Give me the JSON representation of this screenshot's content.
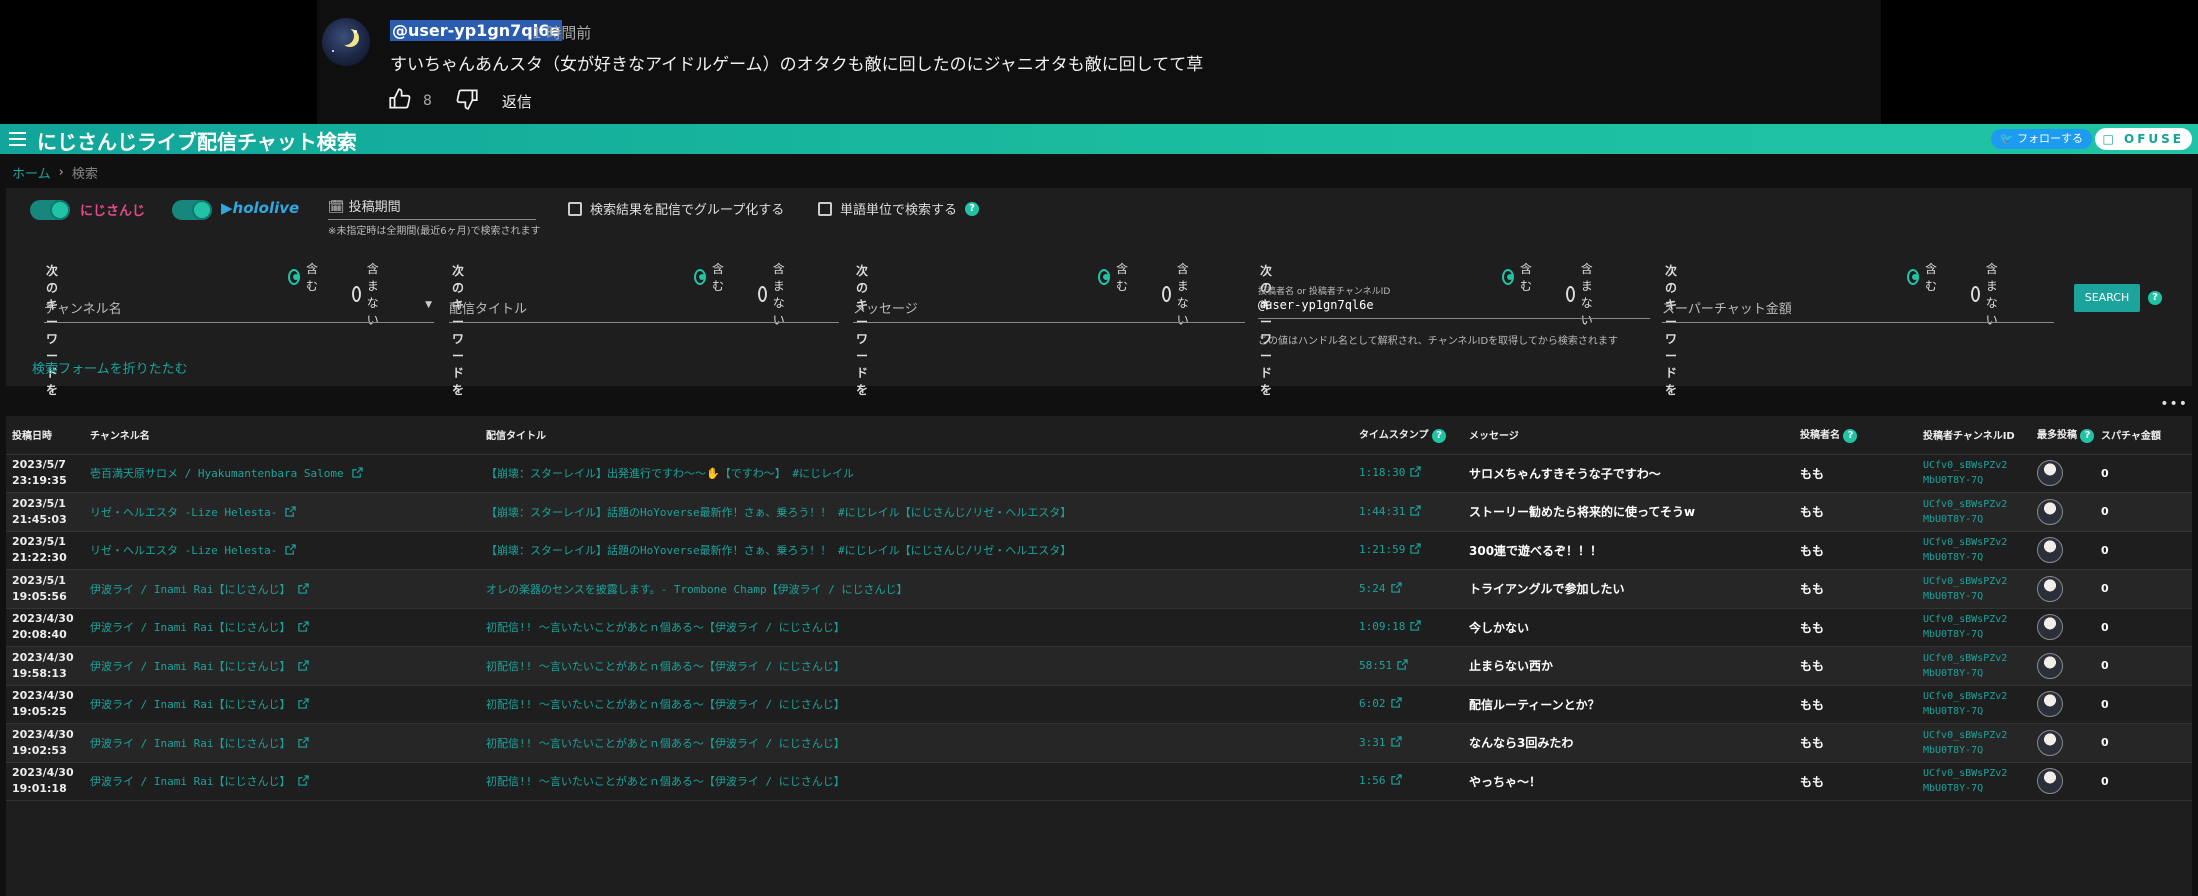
{
  "comment": {
    "handle": "@user-yp1gn7ql6e",
    "time": "1 時間前",
    "text": "すいちゃんあんスタ（女が好きなアイドルゲーム）のオタクも敵に回したのにジャニオタも敵に回してて草",
    "likes": "8",
    "reply": "返信"
  },
  "appbar": {
    "title": "にじさんじライブ配信チャット検索",
    "follow": "フォローする",
    "ofuse": "OFUSE"
  },
  "breadcrumb": {
    "home": "ホーム",
    "current": "検索"
  },
  "form": {
    "logo_niji": "にじさんじ",
    "logo_holo": "hololive",
    "period_label": "投稿期間",
    "period_note": "※未指定時は全期間(最近6ヶ月)で検索されます",
    "group_label": "検索結果を配信でグループ化する",
    "word_label": "単語単位で検索する",
    "keyword_label": "次のキーワードを",
    "include": "含む",
    "exclude": "含まない",
    "channel_placeholder": "チャンネル名",
    "title_placeholder": "配信タイトル",
    "message_placeholder": "メッセージ",
    "uploader_label": "投稿者名 or 投稿者チャンネルID",
    "uploader_value": "@user-yp1gn7ql6e",
    "uploader_note": "この値はハンドル名として解釈され、チャンネルIDを取得してから検索されます",
    "superchat_placeholder": "スーパーチャット金額",
    "search": "SEARCH",
    "fold": "検索フォームを折りたたむ",
    "help": "?"
  },
  "table": {
    "headers": [
      "投稿日時",
      "チャンネル名",
      "配信タイトル",
      "タイムスタンプ",
      "メッセージ",
      "投稿者名",
      "投稿者チャンネルID",
      "最多投稿",
      "スパチャ金額"
    ],
    "rows": [
      {
        "date": "2023/5/7",
        "time": "23:19:35",
        "channel": "壱百満天原サロメ / Hyakumantenbara Salome",
        "title": "【崩壊：スターレイル】出発進行ですわ～～✋【ですわ～】 #にじレイル",
        "ts": "1:18:30",
        "msg": "サロメちゃんすきそうな子ですわ～",
        "name": "もも",
        "cid1": "UCfv0_sBWsPZv2",
        "cid2": "MbU0T8Y-7Q",
        "amount": "0"
      },
      {
        "date": "2023/5/1",
        "time": "21:45:03",
        "channel": "リゼ・ヘルエスタ -Lize Helesta-",
        "title": "【崩壊：スターレイル】話題のHoYoverse最新作！さぁ、乗ろう！！ #にじレイル【にじさんじ/リゼ・ヘルエスタ】",
        "ts": "1:44:31",
        "msg": "ストーリー勧めたら将来的に使ってそうw",
        "name": "もも",
        "cid1": "UCfv0_sBWsPZv2",
        "cid2": "MbU0T8Y-7Q",
        "amount": "0"
      },
      {
        "date": "2023/5/1",
        "time": "21:22:30",
        "channel": "リゼ・ヘルエスタ -Lize Helesta-",
        "title": "【崩壊：スターレイル】話題のHoYoverse最新作！さぁ、乗ろう！！ #にじレイル【にじさんじ/リゼ・ヘルエスタ】",
        "ts": "1:21:59",
        "msg": "300連で遊べるぞ！！！",
        "name": "もも",
        "cid1": "UCfv0_sBWsPZv2",
        "cid2": "MbU0T8Y-7Q",
        "amount": "0"
      },
      {
        "date": "2023/5/1",
        "time": "19:05:56",
        "channel": "伊波ライ / Inami Rai【にじさんじ】",
        "title": "オレの楽器のセンスを披露します。- Trombone Champ【伊波ライ / にじさんじ】",
        "ts": "5:24",
        "msg": "トライアングルで参加したい",
        "name": "もも",
        "cid1": "UCfv0_sBWsPZv2",
        "cid2": "MbU0T8Y-7Q",
        "amount": "0"
      },
      {
        "date": "2023/4/30",
        "time": "20:08:40",
        "channel": "伊波ライ / Inami Rai【にじさんじ】",
        "title": "初配信!! ～言いたいことがあとｎ個ある～【伊波ライ / にじさんじ】",
        "ts": "1:09:18",
        "msg": "今しかない",
        "name": "もも",
        "cid1": "UCfv0_sBWsPZv2",
        "cid2": "MbU0T8Y-7Q",
        "amount": "0"
      },
      {
        "date": "2023/4/30",
        "time": "19:58:13",
        "channel": "伊波ライ / Inami Rai【にじさんじ】",
        "title": "初配信!! ～言いたいことがあとｎ個ある～【伊波ライ / にじさんじ】",
        "ts": "58:51",
        "msg": "止まらない西か",
        "name": "もも",
        "cid1": "UCfv0_sBWsPZv2",
        "cid2": "MbU0T8Y-7Q",
        "amount": "0"
      },
      {
        "date": "2023/4/30",
        "time": "19:05:25",
        "channel": "伊波ライ / Inami Rai【にじさんじ】",
        "title": "初配信!! ～言いたいことがあとｎ個ある～【伊波ライ / にじさんじ】",
        "ts": "6:02",
        "msg": "配信ルーティーンとか？",
        "name": "もも",
        "cid1": "UCfv0_sBWsPZv2",
        "cid2": "MbU0T8Y-7Q",
        "amount": "0"
      },
      {
        "date": "2023/4/30",
        "time": "19:02:53",
        "channel": "伊波ライ / Inami Rai【にじさんじ】",
        "title": "初配信!! ～言いたいことがあとｎ個ある～【伊波ライ / にじさんじ】",
        "ts": "3:31",
        "msg": "なんなら3回みたわ",
        "name": "もも",
        "cid1": "UCfv0_sBWsPZv2",
        "cid2": "MbU0T8Y-7Q",
        "amount": "0"
      },
      {
        "date": "2023/4/30",
        "time": "19:01:18",
        "channel": "伊波ライ / Inami Rai【にじさんじ】",
        "title": "初配信!! ～言いたいことがあとｎ個ある～【伊波ライ / にじさんじ】",
        "ts": "1:56",
        "msg": "やっちゃ～！",
        "name": "もも",
        "cid1": "UCfv0_sBWsPZv2",
        "cid2": "MbU0T8Y-7Q",
        "amount": "0"
      }
    ]
  },
  "colors": {
    "accent": "#1ba39c",
    "appbar": "#1bbf9f",
    "panel": "#1e1e1e"
  }
}
